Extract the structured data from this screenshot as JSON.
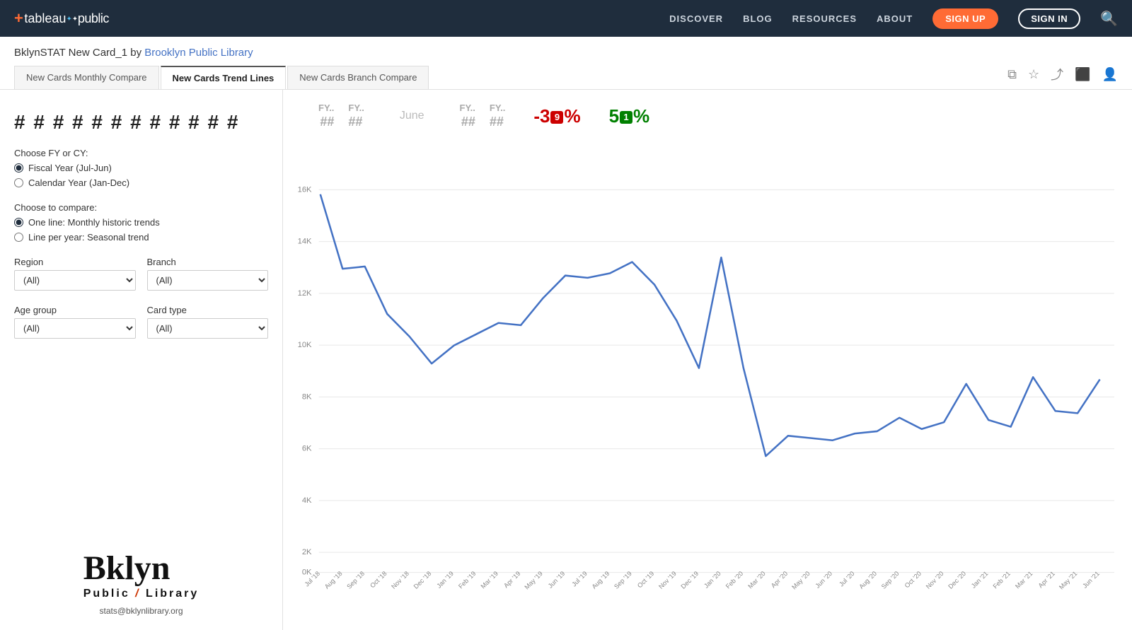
{
  "navbar": {
    "logo": "+tableau·public",
    "links": [
      "DISCOVER",
      "BLOG",
      "RESOURCES",
      "ABOUT"
    ],
    "signup_label": "SIGN UP",
    "signin_label": "SIGN IN"
  },
  "page": {
    "title_prefix": "BklynSTAT New Card_1 by",
    "title_link": "Brooklyn Public Library",
    "icon_copy": "⧉",
    "icon_star": "☆",
    "icon_share": "⤴",
    "icon_present": "⬜",
    "icon_user": "◯"
  },
  "tabs": [
    {
      "label": "New Cards Monthly Compare",
      "active": false
    },
    {
      "label": "New Cards Trend Lines",
      "active": true
    },
    {
      "label": "New Cards Branch Compare",
      "active": false
    }
  ],
  "sidebar": {
    "hash_display": "# # # # # # # # # # # #",
    "fy_cy_label": "Choose FY or CY:",
    "fy_option": "Fiscal Year (Jul-Jun)",
    "cy_option": "Calendar Year (Jan-Dec)",
    "compare_label": "Choose to compare:",
    "compare_opt1": "One line: Monthly historic trends",
    "compare_opt2": "Line per year: Seasonal trend",
    "region_label": "Region",
    "region_value": "(All)",
    "branch_label": "Branch",
    "branch_value": "(All)",
    "age_label": "Age group",
    "age_value": "(All)",
    "card_type_label": "Card type",
    "card_type_value": "(All)",
    "bpl_name1": "Bklyn",
    "bpl_name2": "Public Library",
    "bpl_email": "stats@bklynlibrary.org"
  },
  "chart": {
    "kpi_fy_label1": "FY..",
    "kpi_fy_label2": "FY..",
    "kpi_fy_val1": "##",
    "kpi_fy_val2": "##",
    "kpi_month": "June",
    "kpi_fy_label3": "FY..",
    "kpi_fy_label4": "FY..",
    "kpi_fy_val3": "##",
    "kpi_fy_val4": "##",
    "kpi_neg_pct": "-3",
    "kpi_neg_badge": "9",
    "kpi_neg_suffix": "%",
    "kpi_pos_prefix": "5",
    "kpi_pos_badge": "1",
    "kpi_pos_suffix": "%",
    "y_labels": [
      "16K",
      "14K",
      "12K",
      "10K",
      "8K",
      "6K",
      "4K",
      "2K",
      "0K"
    ],
    "x_labels": [
      "Jul '18",
      "Aug '18",
      "Sep '18",
      "Oct '18",
      "Nov '18",
      "Dec '18",
      "Jan '19",
      "Feb '19",
      "Mar '19",
      "Apr '19",
      "May '19",
      "Jun '19",
      "Jul '19",
      "Aug '19",
      "Sep '19",
      "Oct '19",
      "Nov '19",
      "Dec '19",
      "Jan '20",
      "Feb '20",
      "Mar '20",
      "Apr '20",
      "May '20",
      "Jun '20",
      "Jul '20",
      "Aug '20",
      "Sep '20",
      "Oct '20",
      "Nov '20",
      "Dec '20",
      "Jan '21",
      "Feb '21",
      "Mar '21",
      "Apr '21",
      "May '21",
      "Jun '21"
    ],
    "line_color": "#4472c4",
    "data_points": [
      15800,
      12500,
      12600,
      10500,
      9500,
      8300,
      9100,
      9600,
      10100,
      10000,
      11200,
      12200,
      12100,
      12300,
      12800,
      11800,
      10200,
      8100,
      13000,
      8100,
      4200,
      5100,
      5000,
      4900,
      5200,
      5300,
      5900,
      5400,
      5700,
      7400,
      5800,
      5500,
      7700,
      6200,
      6100,
      7600
    ]
  }
}
